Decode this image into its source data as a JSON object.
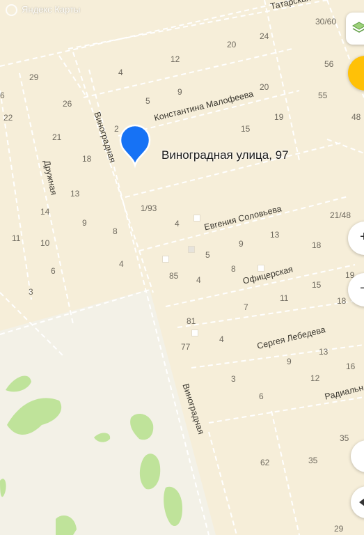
{
  "map": {
    "logo_text": "Яндекс Карты",
    "pin_label": "Виноградная улица, 97",
    "colors": {
      "background": "#f6eed9",
      "park": "#f3f1e7",
      "vegetation": "#bfe39a",
      "street_dash": "#ffffff",
      "pin": "#1672f5",
      "accent_button": "#ffc107"
    },
    "streets": {
      "tatarskaya": "Татарская",
      "konstantina_malofeeva": "Константина Малофеева",
      "vinogradnaya_top": "Виноградная",
      "druzhnaya": "Дружная",
      "evgeniya_solovieva": "Евгения Соловьева",
      "ofitserskaya": "Офицерская",
      "sergeya_lebedeva": "Сергея Лебедева",
      "vinogradnaya_bottom": "Виноградная",
      "radialnaya": "Радиальн"
    },
    "house_numbers": [
      "29",
      "26",
      "21",
      "18",
      "13",
      "9",
      "14",
      "10",
      "11",
      "6",
      "3",
      "4",
      "8",
      "22",
      "6",
      "4",
      "12",
      "20",
      "24",
      "30/60",
      "5",
      "9",
      "20",
      "15",
      "19",
      "2",
      "56",
      "55",
      "48",
      "1/93",
      "4",
      "5",
      "9",
      "13",
      "18",
      "21/48",
      "85",
      "4",
      "8",
      "7",
      "11",
      "15",
      "19",
      "18",
      "81",
      "4",
      "77",
      "9",
      "13",
      "16",
      "3",
      "6",
      "12",
      "62",
      "35",
      "35",
      "29"
    ]
  },
  "controls": {
    "layers_icon": "layers-icon",
    "location_icon": "location-icon",
    "zoom_in_icon": "zoom-in-icon",
    "zoom_out_icon": "zoom-out-icon",
    "zoom_in_glyph": "+",
    "zoom_out_glyph": "−",
    "back_icon": "back-icon"
  }
}
